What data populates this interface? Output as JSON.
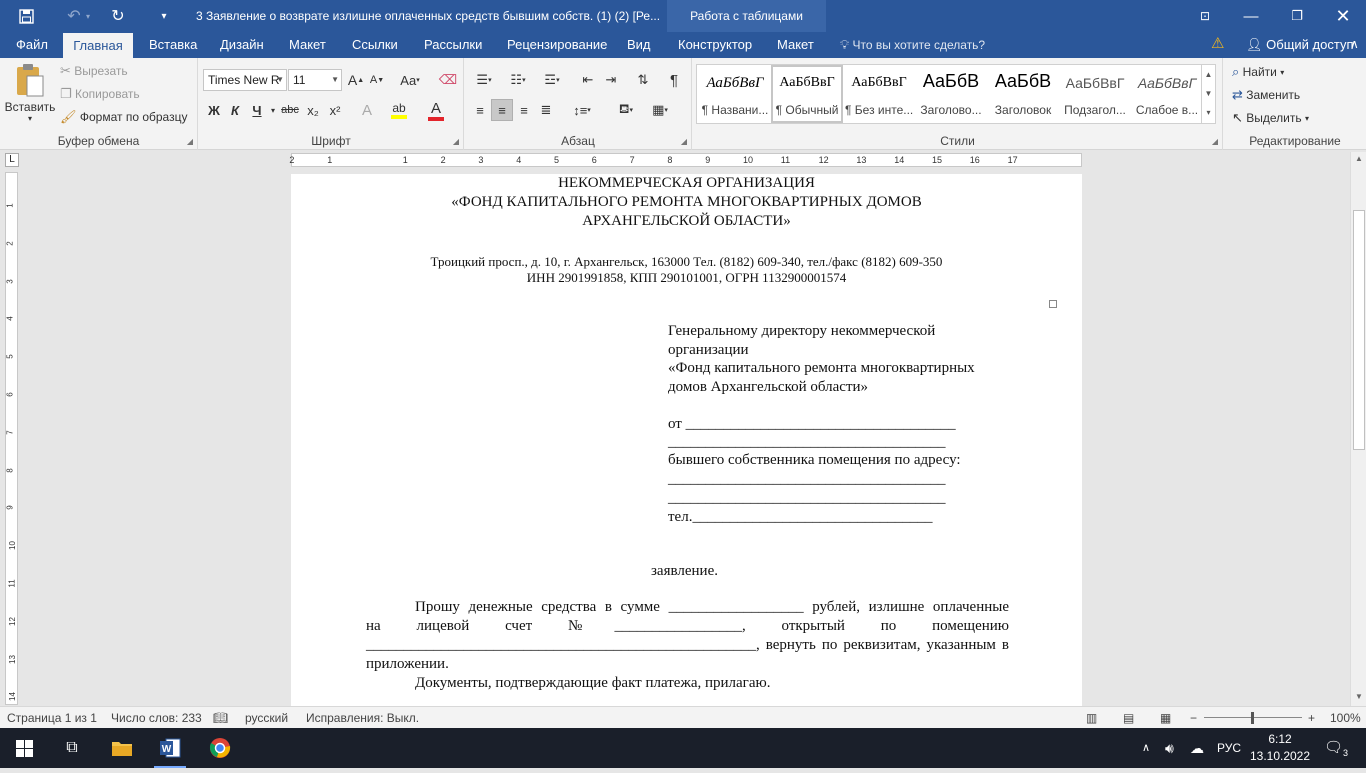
{
  "titlebar": {
    "doc_title": "3 Заявление о возврате излишне оплаченных средств бывшим собств. (1) (2) [Ре...",
    "context_tab": "Работа с таблицами"
  },
  "tabs": [
    "Файл",
    "Главная",
    "Вставка",
    "Дизайн",
    "Макет",
    "Ссылки",
    "Рассылки",
    "Рецензирование",
    "Вид",
    "Конструктор",
    "Макет"
  ],
  "tell_me": "Что вы хотите сделать?",
  "share": "Общий доступ",
  "ribbon": {
    "clipboard": {
      "label": "Буфер обмена",
      "paste": "Вставить",
      "cut": "Вырезать",
      "copy": "Копировать",
      "format_painter": "Формат по образцу"
    },
    "font": {
      "label": "Шрифт",
      "font_name": "Times New R",
      "font_size": "11",
      "bold": "Ж",
      "italic": "К",
      "underline": "Ч",
      "strike": "abc",
      "subscript": "x₂",
      "superscript": "x²",
      "case": "Aa",
      "grow": "A",
      "shrink": "A",
      "font_color_hex": "#e3242b",
      "highlight_hex": "#ffff00"
    },
    "paragraph": {
      "label": "Абзац"
    },
    "styles": {
      "label": "Стили",
      "items": [
        {
          "sample": "АаБбВвГ",
          "name": "¶ Названи..."
        },
        {
          "sample": "АаБбВвГ",
          "name": "¶ Обычный"
        },
        {
          "sample": "АаБбВвГ",
          "name": "¶ Без инте..."
        },
        {
          "sample": "АаБбВ",
          "name": "Заголово..."
        },
        {
          "sample": "АаБбВ",
          "name": "Заголовок"
        },
        {
          "sample": "АаБбВвГ",
          "name": "Подзагол..."
        },
        {
          "sample": "АаБбВвГ",
          "name": "Слабое в..."
        }
      ]
    },
    "editing": {
      "label": "Редактирование",
      "find": "Найти",
      "replace": "Заменить",
      "select": "Выделить"
    }
  },
  "ruler": {
    "h_numbers": [
      "2",
      "1",
      "1",
      "2",
      "3",
      "4",
      "5",
      "6",
      "7",
      "8",
      "9",
      "10",
      "11",
      "12",
      "13",
      "14",
      "15",
      "16",
      "17"
    ],
    "v_numbers": [
      "1",
      "2",
      "3",
      "4",
      "5",
      "6",
      "7",
      "8",
      "9",
      "10",
      "11",
      "12",
      "13",
      "14"
    ]
  },
  "document": {
    "org_line1": "НЕКОММЕРЧЕСКАЯ ОРГАНИЗАЦИЯ",
    "org_line2": "«ФОНД КАПИТАЛЬНОГО РЕМОНТА МНОГОКВАРТИРНЫХ ДОМОВ",
    "org_line3": "АРХАНГЕЛЬСКОЙ ОБЛАСТИ»",
    "address": "Троицкий просп., д. 10, г. Архангельск, 163000 Тел. (8182) 609-340, тел./факс (8182) 609-350",
    "requisites": "ИНН 2901991858, КПП 290101001, ОГРН 1132900001574",
    "to1": "Генеральному директору некоммерческой",
    "to2": "организации",
    "to3": "«Фонд капитального ремонта многоквартирных",
    "to4": "домов Архангельской области»",
    "from": "от ____________________________________",
    "line_blank": "_____________________________________",
    "owner": "бывшего собственника помещения по адресу:",
    "tel": "тел.________________________________",
    "heading": "заявление.",
    "body1": "Прошу денежные средства в сумме __________________ рублей, излишне оплаченные",
    "body2": "на лицевой счет №_________________, открытый по помещению",
    "body3": "____________________________________________________, вернуть по реквизитам, указанным в",
    "body4": "приложении.",
    "body5": "Документы, подтверждающие факт платежа, прилагаю."
  },
  "status": {
    "page": "Страница 1 из 1",
    "words": "Число слов: 233",
    "lang": "русский",
    "track": "Исправления: Выкл.",
    "zoom": "100%"
  },
  "taskbar": {
    "lang": "РУС",
    "time": "6:12",
    "date": "13.10.2022",
    "notif_count": "3"
  }
}
